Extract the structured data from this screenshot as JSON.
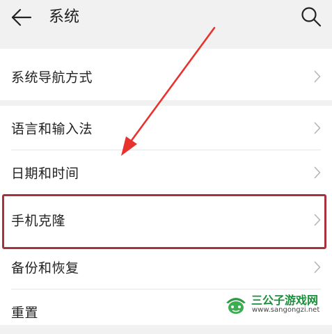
{
  "header": {
    "title": "系统",
    "back_icon": "back-arrow-icon",
    "search_icon": "search-icon"
  },
  "group1": {
    "items": [
      {
        "label": "系统导航方式"
      }
    ]
  },
  "group2": {
    "items": [
      {
        "label": "语言和输入法"
      },
      {
        "label": "日期和时间"
      },
      {
        "label": "手机克隆"
      },
      {
        "label": "备份和恢复"
      },
      {
        "label": "重置"
      }
    ]
  },
  "annotation": {
    "highlighted_item": "手机克隆",
    "color": "#a8323c",
    "arrow_color": "#e8322d"
  },
  "watermark": {
    "text": "三公子游戏网",
    "url": "www.sangongzi.net"
  }
}
